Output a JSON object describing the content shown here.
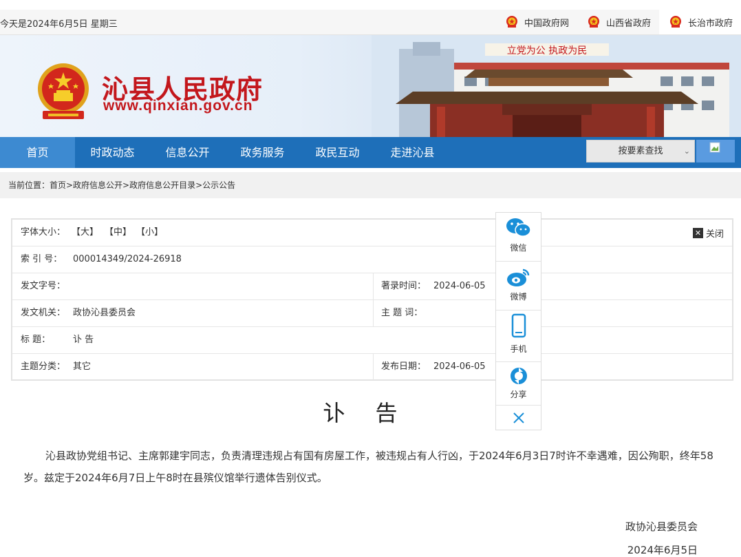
{
  "topbar": {
    "date_text": "今天是2024年6月5日 星期三",
    "links": [
      "中国政府网",
      "山西省政府",
      "长治市政府"
    ]
  },
  "header": {
    "site_name": "沁县人民政府",
    "site_url": "www.qinxian.gov.cn",
    "gate_slogan": "立党为公 执政为民"
  },
  "nav": {
    "items": [
      "首页",
      "时政动态",
      "信息公开",
      "政务服务",
      "政民互动",
      "走进沁县"
    ],
    "search_select": "按要素查找"
  },
  "breadcrumb": "当前位置：首页>政府信息公开>政府信息公开目录>公示公告",
  "meta": {
    "font_size_label": "字体大小：",
    "font_big": "【大】",
    "font_mid": "【中】",
    "font_small": "【小】",
    "close_label": "关闭",
    "index_label": "索  引  号：",
    "index_value": "000014349/2024-26918",
    "doc_no_label": "发文字号：",
    "doc_no_value": "",
    "record_time_label": "著录时间：",
    "record_time_value": "2024-06-05",
    "issuer_label": "发文机关：",
    "issuer_value": "政协沁县委员会",
    "keywords_label": "主  题  词：",
    "keywords_value": "",
    "title_label": "标        题：",
    "title_value": "讣    告",
    "category_label": "主题分类：",
    "category_value": "其它",
    "publish_date_label": "发布日期：",
    "publish_date_value": "2024-06-05"
  },
  "share": {
    "wechat": "微信",
    "weibo": "微博",
    "mobile": "手机",
    "share": "分享"
  },
  "document": {
    "title": "讣告",
    "body": "沁县政协党组书记、主席郭建宇同志，负责清理违规占有国有房屋工作，被违规占有人行凶，于2024年6月3日7时许不幸遇难，因公殉职，终年58岁。兹定于2024年6月7日上午8时在县殡仪馆举行遗体告别仪式。",
    "signature": "政协沁县委员会",
    "date": "2024年6月5日"
  },
  "colors": {
    "nav_blue": "#1e6fb9",
    "nav_active": "#3d8ad1",
    "brand_red": "#c3171c",
    "wechat": "#1a8fd8",
    "weibo": "#1a8fd8"
  }
}
